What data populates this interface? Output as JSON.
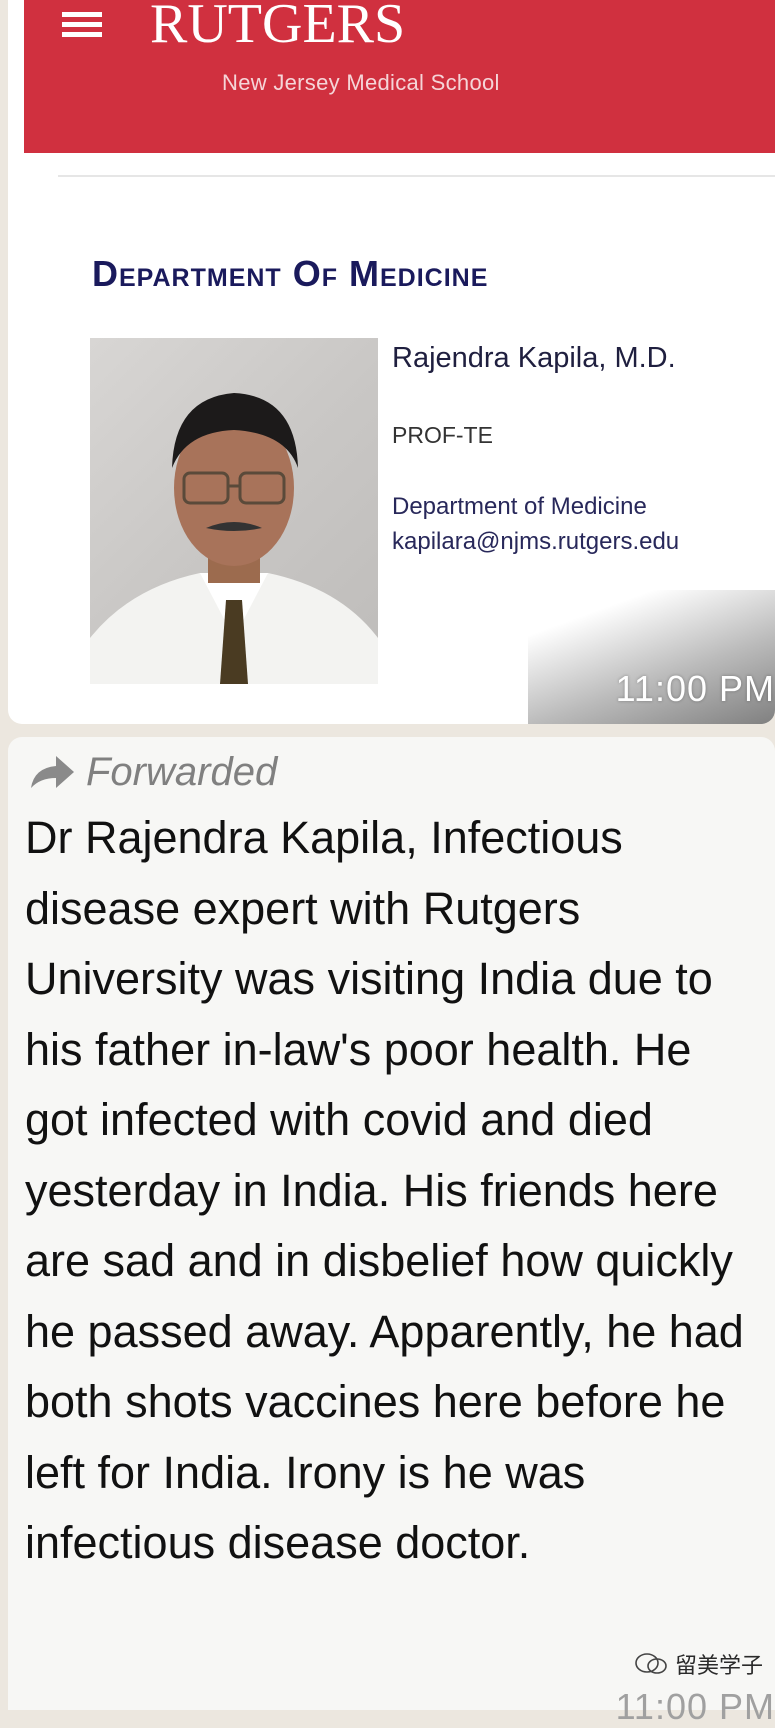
{
  "header": {
    "brand": "RUTGERS",
    "subtitle": "New Jersey Medical School"
  },
  "profile": {
    "department_title": "Department Of Medicine",
    "name": "Rajendra Kapila, M.D.",
    "role": "PROF-TE",
    "department": "Department of Medicine",
    "email": "kapilara@njms.rutgers.edu"
  },
  "image_message": {
    "timestamp": "11:00 PM"
  },
  "forwarded_message": {
    "label": "Forwarded",
    "text": "Dr Rajendra Kapila, Infectious disease expert with Rutgers University was visiting India due to his father in-law's poor health.  He got infected with covid and died yesterday in India.  His friends here are sad and in disbelief how quickly he passed away. Apparently, he had both shots vaccines here before he left for India.  Irony is he was infectious disease doctor.",
    "timestamp": "11:00 PM"
  },
  "watermark": {
    "text": "留美学子"
  },
  "colors": {
    "banner_red": "#d0303f",
    "department_navy": "#1a1a5c",
    "chat_background": "#ece7df",
    "bubble": "#f7f7f5"
  }
}
